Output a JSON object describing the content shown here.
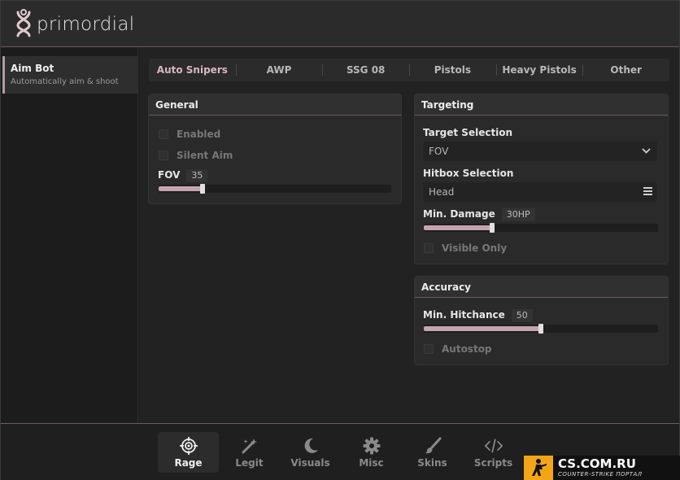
{
  "app": {
    "name": "primordial"
  },
  "sidebar": {
    "items": [
      {
        "title": "Aim Bot",
        "subtitle": "Automatically aim & shoot"
      }
    ]
  },
  "tabs": [
    {
      "label": "Auto Snipers",
      "active": true
    },
    {
      "label": "AWP"
    },
    {
      "label": "SSG 08"
    },
    {
      "label": "Pistols"
    },
    {
      "label": "Heavy Pistols"
    },
    {
      "label": "Other"
    }
  ],
  "general": {
    "title": "General",
    "enabled_label": "Enabled",
    "silent_aim_label": "Silent Aim",
    "fov_label": "FOV",
    "fov_value": "35",
    "fov_fill": 0.19
  },
  "targeting": {
    "title": "Targeting",
    "target_selection_label": "Target Selection",
    "target_selection_value": "FOV",
    "hitbox_selection_label": "Hitbox Selection",
    "hitbox_selection_value": "Head",
    "min_damage_label": "Min. Damage",
    "min_damage_value": "30HP",
    "min_damage_fill": 0.29,
    "visible_only_label": "Visible Only"
  },
  "accuracy": {
    "title": "Accuracy",
    "min_hitchance_label": "Min. Hitchance",
    "min_hitchance_value": "50",
    "min_hitchance_fill": 0.5,
    "autostop_label": "Autostop"
  },
  "bottom_nav": [
    {
      "label": "Rage",
      "icon": "crosshair-icon",
      "active": true
    },
    {
      "label": "Legit",
      "icon": "magic-wand-icon"
    },
    {
      "label": "Visuals",
      "icon": "moon-icon"
    },
    {
      "label": "Misc",
      "icon": "gear-icon"
    },
    {
      "label": "Skins",
      "icon": "brush-icon"
    },
    {
      "label": "Scripts",
      "icon": "code-icon"
    }
  ],
  "watermark": {
    "main": "CS.COM.RU",
    "sub": "COUNTER-STRIKE ПОРТАЛ"
  },
  "colors": {
    "accent": "#c5a4ad",
    "active_tab": "#d9b7c1",
    "divider": "#6d5a60"
  }
}
